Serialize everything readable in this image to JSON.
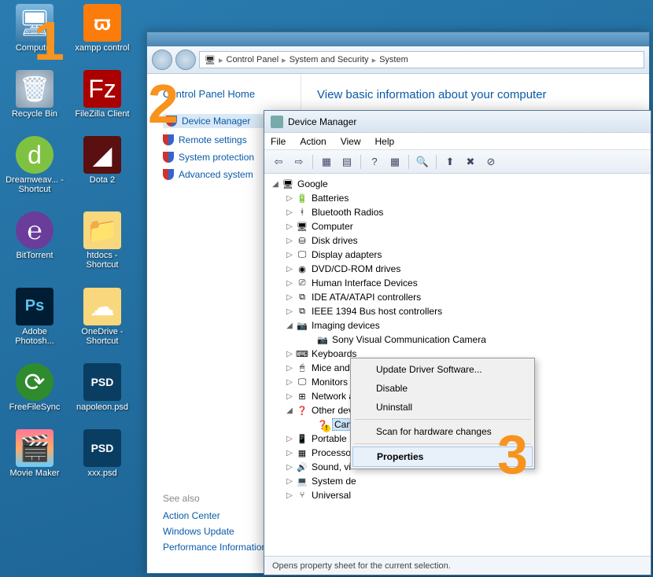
{
  "desktop": {
    "icons": [
      {
        "label": "Computer",
        "cls": "computer",
        "glyph": "🖥"
      },
      {
        "label": "xampp control",
        "cls": "xampp",
        "glyph": "ϖ"
      },
      {
        "label": "Recycle Bin",
        "cls": "bin",
        "glyph": "🗑"
      },
      {
        "label": "FileZilla Client",
        "cls": "filezilla",
        "glyph": "Fz"
      },
      {
        "label": "Dreamweav... - Shortcut",
        "cls": "dreamweaver",
        "glyph": "d"
      },
      {
        "label": "Dota 2",
        "cls": "dota",
        "glyph": "◢"
      },
      {
        "label": "BitTorrent",
        "cls": "bittorrent",
        "glyph": "℮"
      },
      {
        "label": "htdocs - Shortcut",
        "cls": "htdocs",
        "glyph": "📁"
      },
      {
        "label": "Adobe Photosh...",
        "cls": "ps",
        "glyph": "Ps"
      },
      {
        "label": "OneDrive - Shortcut",
        "cls": "onedrive",
        "glyph": "☁"
      },
      {
        "label": "FreeFileSync",
        "cls": "ffs",
        "glyph": "⟳"
      },
      {
        "label": "napoleon.psd",
        "cls": "psd",
        "glyph": "PSD"
      },
      {
        "label": "Movie Maker",
        "cls": "movie",
        "glyph": "🎬"
      },
      {
        "label": "xxx.psd",
        "cls": "psd",
        "glyph": "PSD"
      }
    ]
  },
  "control_panel": {
    "breadcrumb": [
      "Control Panel",
      "System and Security",
      "System"
    ],
    "home": "Control Panel Home",
    "links": [
      {
        "label": "Device Manager",
        "selected": true,
        "shield": true
      },
      {
        "label": "Remote settings",
        "shield": true
      },
      {
        "label": "System protection",
        "shield": true
      },
      {
        "label": "Advanced system",
        "shield": true
      }
    ],
    "heading": "View basic information about your computer",
    "see_also_heading": "See also",
    "see_also": [
      "Action Center",
      "Windows Update",
      "Performance Information and Tools"
    ]
  },
  "device_manager": {
    "title": "Device Manager",
    "menu": [
      "File",
      "Action",
      "View",
      "Help"
    ],
    "root": "Google",
    "nodes": [
      {
        "label": "Batteries",
        "icon": "🔋"
      },
      {
        "label": "Bluetooth Radios",
        "icon": "ᚼ"
      },
      {
        "label": "Computer",
        "icon": "🖥"
      },
      {
        "label": "Disk drives",
        "icon": "⛁"
      },
      {
        "label": "Display adapters",
        "icon": "🖵"
      },
      {
        "label": "DVD/CD-ROM drives",
        "icon": "◉"
      },
      {
        "label": "Human Interface Devices",
        "icon": "⎚"
      },
      {
        "label": "IDE ATA/ATAPI controllers",
        "icon": "⧉"
      },
      {
        "label": "IEEE 1394 Bus host controllers",
        "icon": "⧉"
      },
      {
        "label": "Imaging devices",
        "icon": "📷",
        "expanded": true,
        "children": [
          {
            "label": "Sony Visual Communication Camera",
            "icon": "📷"
          }
        ]
      },
      {
        "label": "Keyboards",
        "icon": "⌨"
      },
      {
        "label": "Mice and other pointing devices",
        "icon": "🖱"
      },
      {
        "label": "Monitors",
        "icon": "🖵"
      },
      {
        "label": "Network adapters",
        "icon": "⊞"
      },
      {
        "label": "Other devices",
        "icon": "❓",
        "expanded": true,
        "children": [
          {
            "label": "CanoScan",
            "icon": "❓",
            "warn": true,
            "selected": true
          }
        ]
      },
      {
        "label": "Portable D",
        "icon": "📱"
      },
      {
        "label": "Processor",
        "icon": "▦"
      },
      {
        "label": "Sound, vi",
        "icon": "🔊"
      },
      {
        "label": "System de",
        "icon": "💻"
      },
      {
        "label": "Universal",
        "icon": "⑂"
      }
    ],
    "status": "Opens property sheet for the current selection."
  },
  "context_menu": {
    "items": [
      {
        "label": "Update Driver Software..."
      },
      {
        "label": "Disable"
      },
      {
        "label": "Uninstall"
      },
      {
        "sep": true
      },
      {
        "label": "Scan for hardware changes"
      },
      {
        "sep": true
      },
      {
        "label": "Properties",
        "highlight": true
      }
    ]
  },
  "annotations": {
    "a1": "1",
    "a2": "2",
    "a3": "3"
  }
}
